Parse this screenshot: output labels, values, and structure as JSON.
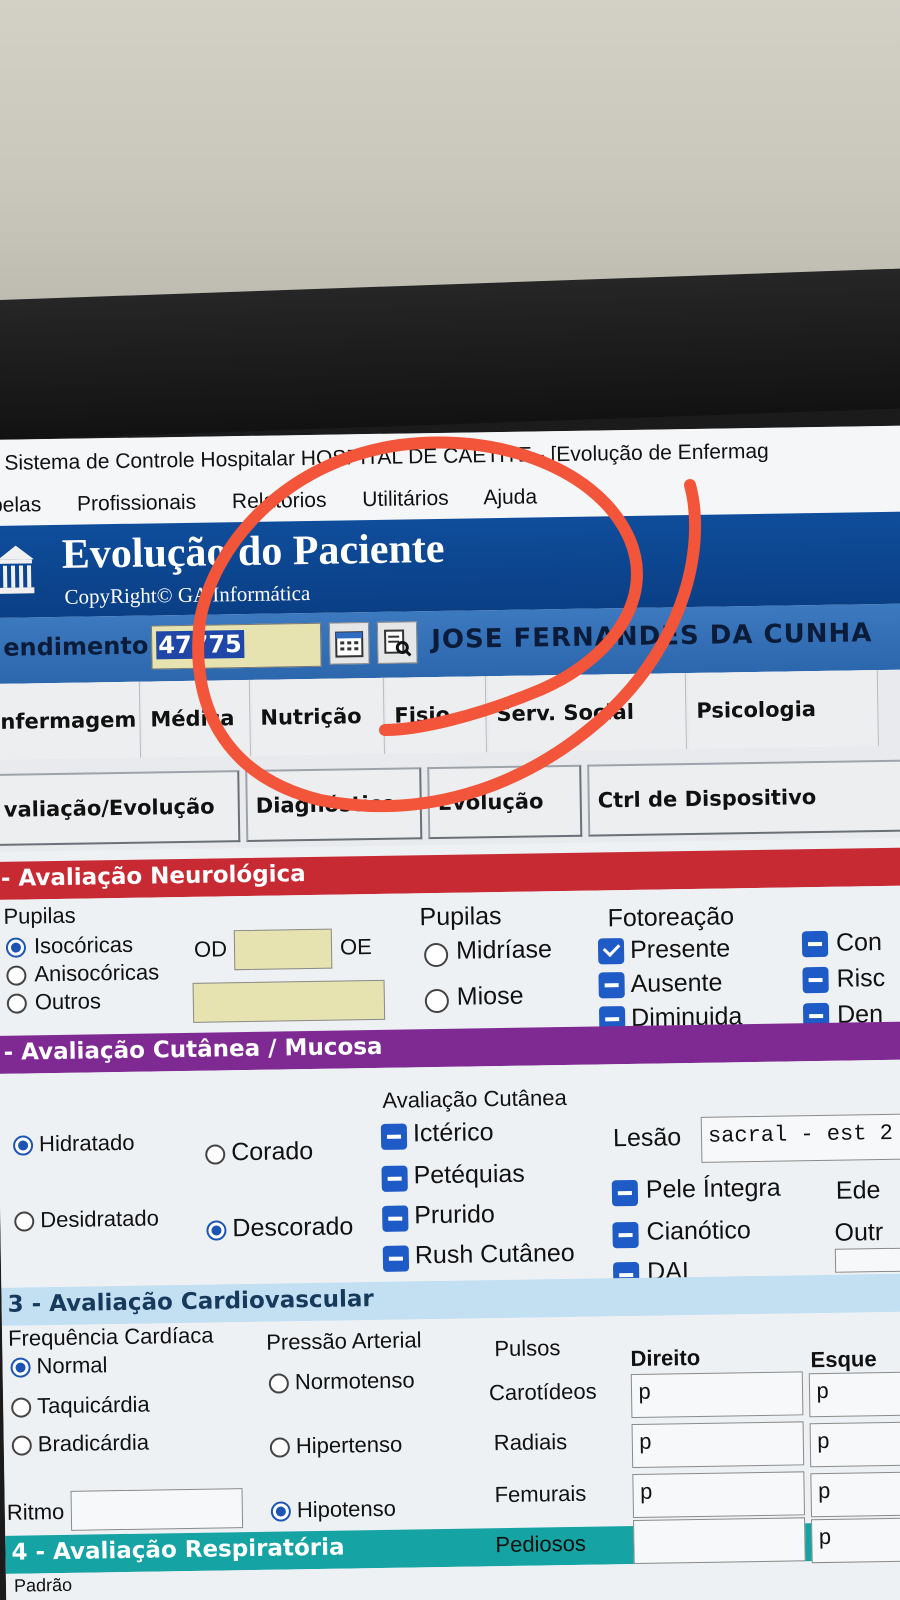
{
  "window": {
    "title": "Sistema de Controle Hospitalar HOSPITAL DE CAETITE - [Evolução de Enfermag"
  },
  "menu": [
    "belas",
    "Profissionais",
    "Relatórios",
    "Utilitários",
    "Ajuda"
  ],
  "banner": {
    "title": "Evolução do Paciente",
    "copyright": "CopyRight© GA Informática"
  },
  "patient": {
    "label": "endimento",
    "number": "47775",
    "name": "JOSE FERNANDES DA CUNHA"
  },
  "icons": [
    "building-icon",
    "calendar-icon",
    "search-record-icon"
  ],
  "tabs": [
    "nfermagem",
    "Médica",
    "Nutrição",
    "Fisio",
    "Serv. Social",
    "Psicologia"
  ],
  "subtabs": [
    "valiação/Evolução",
    "Diagnóstico",
    "Evolução",
    "Ctrl de Dispositivo"
  ],
  "neuro": {
    "title": "- Avaliação Neurológica",
    "pupilas_label": "Pupilas",
    "options": [
      "Isocóricas",
      "Anisocóricas",
      "Outros"
    ],
    "od": "OD",
    "oe": "OE",
    "pupilas2_label": "Pupilas",
    "pupilas2_options": [
      "Midríase",
      "Miose"
    ],
    "foto_label": "Fotoreação",
    "foto_options": [
      "Presente",
      "Ausente",
      "Diminuida"
    ],
    "extra_options": [
      "Con",
      "Risc",
      "Den"
    ]
  },
  "cutanea": {
    "title": "- Avaliação Cutânea / Mucosa",
    "hidr": [
      "Hidratado",
      "Desidratado"
    ],
    "cor": [
      "Corado",
      "Descorado"
    ],
    "aval_label": "Avaliação Cutânea",
    "aval_options": [
      "Ictérico",
      "Petéquias",
      "Prurido",
      "Rush Cutâneo"
    ],
    "lesao_label": "Lesão",
    "lesao_value": "sacral - est 2",
    "pele_options": [
      "Pele Íntegra",
      "Cianótico",
      "DAI"
    ],
    "ede": "Ede",
    "outr": "Outr"
  },
  "cardio": {
    "title": "3 - Avaliação Cardiovascular",
    "freq_label": "Frequência Cardíaca",
    "freq_options": [
      "Normal",
      "Taquicárdia",
      "Bradicárdia"
    ],
    "press_label": "Pressão Arterial",
    "press_options": [
      "Normotenso",
      "Hipertenso",
      "Hipotenso"
    ],
    "ritmo": "Ritmo",
    "pulsos_label": "Pulsos",
    "pulsos": [
      "Carotídeos",
      "Radiais",
      "Femurais",
      "Pediosos"
    ],
    "direito": "Direito",
    "esquerdo": "Esque",
    "pulse_value": "p"
  },
  "resp": {
    "title": "4 - Avaliação Respiratória",
    "padrao": "Padrão"
  },
  "colors": {
    "banner": "#0a3f85",
    "neuro": "#c72a33",
    "cutanea": "#7f2a93",
    "cardio": "#c3dff2",
    "resp": "#16a3a3",
    "annotation": "#f2553a"
  }
}
